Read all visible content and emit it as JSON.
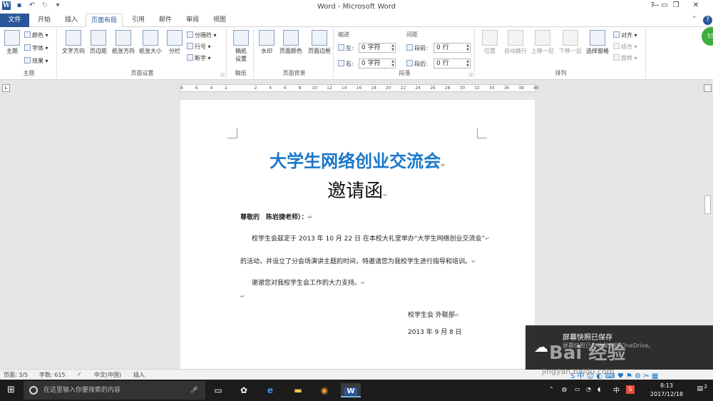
{
  "title": "Word - Microsoft Word",
  "tabs": [
    "文件",
    "开始",
    "插入",
    "页面布局",
    "引用",
    "邮件",
    "审阅",
    "视图"
  ],
  "ribbon": {
    "theme_group": {
      "label": "主题",
      "theme_btn": "主题",
      "colors": "颜色",
      "fonts": "字体",
      "effects": "效果"
    },
    "page_setup": {
      "label": "页面设置",
      "text_dir": "文字方向",
      "margins": "页边距",
      "orientation": "纸张方向",
      "size": "纸张大小",
      "columns": "分栏",
      "breaks": "分隔符",
      "line_numbers": "行号",
      "hyphenation": "断字"
    },
    "draft": {
      "label": "稿纸",
      "btn": "稿纸\n设置"
    },
    "page_bg": {
      "label": "页面背景",
      "watermark": "水印",
      "page_color": "页面颜色",
      "page_border": "页面边框"
    },
    "paragraph": {
      "label": "段落",
      "indent": "缩进",
      "spacing": "间距",
      "left": "左:",
      "right": "右:",
      "before": "段前:",
      "after": "段后:",
      "left_val": "0 字符",
      "right_val": "0 字符",
      "before_val": "0 行",
      "after_val": "0 行"
    },
    "arrange": {
      "label": "排列",
      "position": "位置",
      "wrap": "自动换行",
      "forward": "上移一层",
      "backward": "下移一层",
      "selection": "选择窗格",
      "align": "对齐",
      "group": "组合",
      "rotate": "旋转"
    }
  },
  "ruler": [
    "8",
    "6",
    "4",
    "2",
    "",
    "2",
    "4",
    "6",
    "8",
    "10",
    "12",
    "14",
    "16",
    "18",
    "20",
    "22",
    "24",
    "26",
    "28",
    "30",
    "32",
    "34",
    "36",
    "38",
    "40"
  ],
  "document": {
    "title": "大学生网络创业交流会",
    "subtitle": "邀请函",
    "greeting": "尊敬的　陈岩捷老师）：",
    "line1": "校学生会兹定于 2013 年 10 月 22 日 在本校大礼堂举办“大学生网络创业交流会”",
    "line2": "的活动，并设立了分会场演讲主题的时间，特邀请您为我校学生进行指导和培训。",
    "line3": "谢谢您对我校学生会工作的大力支持。",
    "sign": "校学生会 外联部",
    "date": "2013 年 9 月 8 日"
  },
  "status": {
    "page": "页面: 3/5",
    "words": "字数: 615",
    "lang": "中文(中国)",
    "mode": "插入"
  },
  "taskbar": {
    "search_placeholder": "在这里输入你要搜索的内容",
    "time": "8:13",
    "date": "2017/12/18",
    "ime": "中",
    "notif": "2"
  },
  "toast": {
    "title": "屏幕快照已保存",
    "body": "屏幕快照已自动保存到 OneDrive。"
  },
  "watermark": {
    "main": "Bai 经验",
    "sub": "jingyan.baidu.com"
  }
}
